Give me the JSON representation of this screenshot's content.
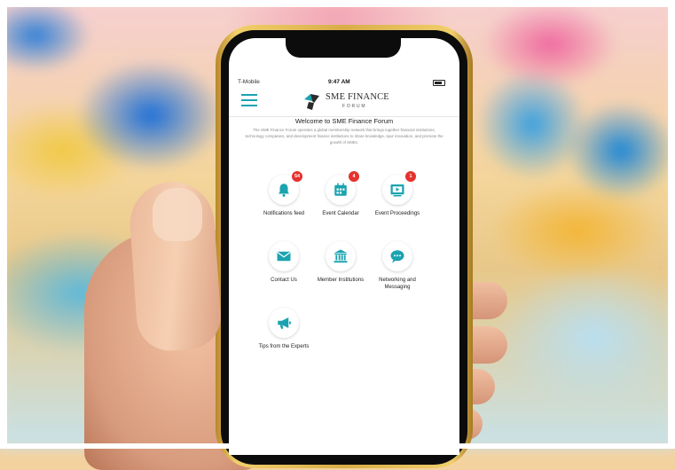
{
  "status_bar": {
    "carrier": "T-Mobile",
    "time": "9:47 AM"
  },
  "header": {
    "logo_title": "SME FINANCE",
    "logo_subtitle": "FORUM"
  },
  "intro": {
    "welcome": "Welcome to SME Finance Forum",
    "description": "The SME Finance Forum operates a global membership network that brings together financial institutions, technology companies, and development finance institutions to share knowledge, spur innovation, and promote the growth of SMEs."
  },
  "tiles": [
    {
      "label": "Notifications feed",
      "icon": "bell-icon",
      "badge": "54"
    },
    {
      "label": "Event Calendar",
      "icon": "calendar-icon",
      "badge": "4"
    },
    {
      "label": "Event Proceedings",
      "icon": "video-icon",
      "badge": "1"
    },
    {
      "label": "Contact Us",
      "icon": "envelope-icon",
      "badge": ""
    },
    {
      "label": "Member Institutions",
      "icon": "bank-icon",
      "badge": ""
    },
    {
      "label": "Networking and Messaging",
      "icon": "chat-bubble-icon",
      "badge": ""
    },
    {
      "label": "Tips from the Experts",
      "icon": "megaphone-icon",
      "badge": ""
    }
  ],
  "colors": {
    "accent": "#1ba3b0",
    "badge": "#e5322e",
    "phone_frame": "#d8ad48"
  }
}
